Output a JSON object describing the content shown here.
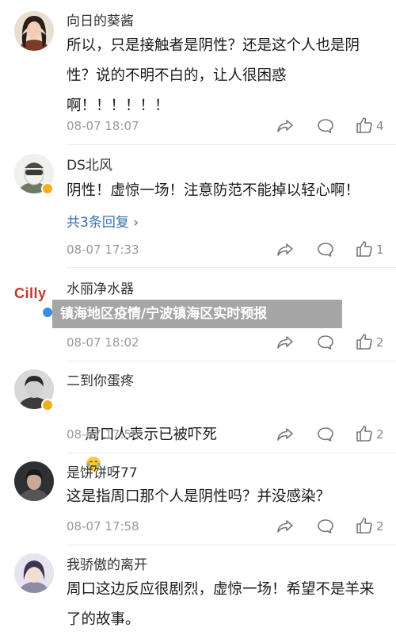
{
  "banner": {
    "title": "镇海地区疫情/宁波镇海区实时预报"
  },
  "comments": [
    {
      "username": "向日的葵酱",
      "content": "所以，只是接触者是阴性？还是这个人也是阴性？说的不明不白的，让人很困惑\n啊！！！！！！",
      "time": "08-07 18:07",
      "likes": "4"
    },
    {
      "username": "DS北风",
      "content": "阴性！虚惊一场！注意防范不能掉以轻心啊！",
      "replies": "共3条回复",
      "replies_arrow": "›",
      "time": "08-07 17:33",
      "likes": "1"
    },
    {
      "username": "水丽净水器",
      "avatar_text": "Cilly",
      "time": "08-07 18:02",
      "likes": "2"
    },
    {
      "username": "二到你蛋疼",
      "content": "周口人表示已被吓死",
      "time": "08-07 17:56",
      "likes": "2"
    },
    {
      "username": "是饼饼呀77",
      "content": "这是指周口那个人是阴性吗？并没感染？",
      "time": "08-07 17:58",
      "likes": "2"
    },
    {
      "username": "我骄傲的离开",
      "content": "周口这边反应很剧烈，虚惊一场！希望不是羊来了的故事。"
    }
  ],
  "colors": {
    "reply_link": "#3a6fb0",
    "meta": "#9a9a9a",
    "badge_gold": "#f2ae1c",
    "badge_blue": "#3a8ee6"
  }
}
